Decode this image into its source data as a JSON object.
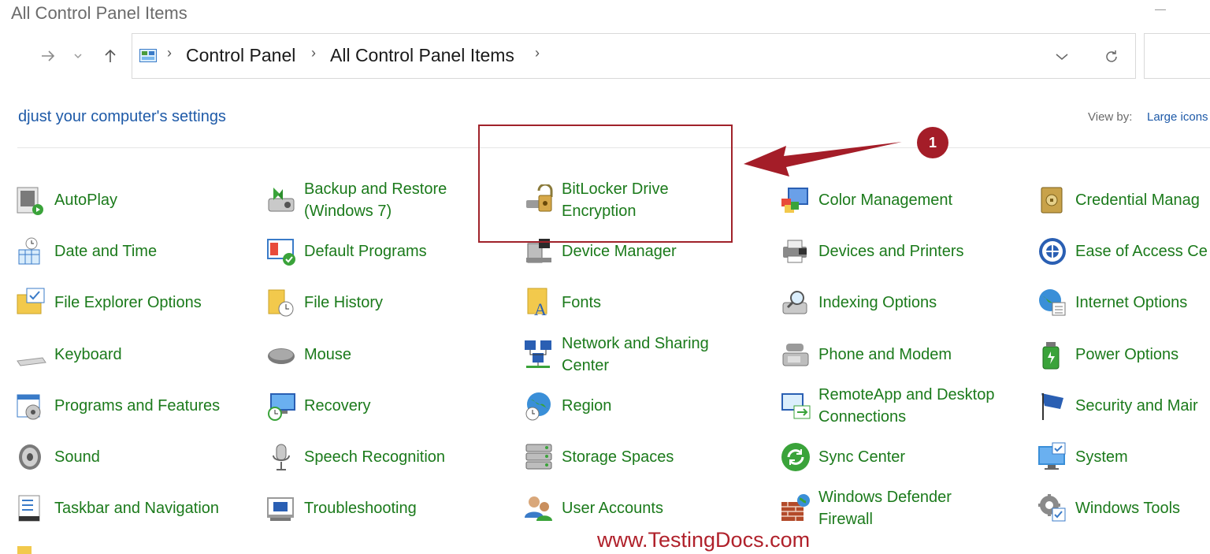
{
  "window": {
    "title": "All Control Panel Items"
  },
  "addressbar": {
    "crumbs": [
      "Control Panel",
      "All Control Panel Items"
    ]
  },
  "header": {
    "heading": "djust your computer's settings",
    "view_by_label": "View by:",
    "view_by_value": "Large icons"
  },
  "items": [
    {
      "label": "AutoPlay",
      "icon": "autoplay-icon"
    },
    {
      "label": "Backup and Restore\n(Windows 7)",
      "icon": "backup-restore-icon"
    },
    {
      "label": "BitLocker Drive\nEncryption",
      "icon": "bitlocker-icon"
    },
    {
      "label": "Color Management",
      "icon": "color-management-icon"
    },
    {
      "label": "Credential Manag",
      "icon": "credential-manager-icon"
    },
    {
      "label": "Date and Time",
      "icon": "date-time-icon"
    },
    {
      "label": "Default Programs",
      "icon": "default-programs-icon"
    },
    {
      "label": "Device Manager",
      "icon": "device-manager-icon"
    },
    {
      "label": "Devices and Printers",
      "icon": "devices-printers-icon"
    },
    {
      "label": "Ease of Access Ce",
      "icon": "ease-of-access-icon"
    },
    {
      "label": "File Explorer Options",
      "icon": "file-explorer-options-icon"
    },
    {
      "label": "File History",
      "icon": "file-history-icon"
    },
    {
      "label": "Fonts",
      "icon": "fonts-icon"
    },
    {
      "label": "Indexing Options",
      "icon": "indexing-options-icon"
    },
    {
      "label": "Internet Options",
      "icon": "internet-options-icon"
    },
    {
      "label": "Keyboard",
      "icon": "keyboard-icon"
    },
    {
      "label": "Mouse",
      "icon": "mouse-icon"
    },
    {
      "label": "Network and Sharing\nCenter",
      "icon": "network-sharing-icon"
    },
    {
      "label": "Phone and Modem",
      "icon": "phone-modem-icon"
    },
    {
      "label": "Power Options",
      "icon": "power-options-icon"
    },
    {
      "label": "Programs and Features",
      "icon": "programs-features-icon"
    },
    {
      "label": "Recovery",
      "icon": "recovery-icon"
    },
    {
      "label": "Region",
      "icon": "region-icon"
    },
    {
      "label": "RemoteApp and Desktop\nConnections",
      "icon": "remoteapp-icon"
    },
    {
      "label": "Security and Mair",
      "icon": "security-maintenance-icon"
    },
    {
      "label": "Sound",
      "icon": "sound-icon"
    },
    {
      "label": "Speech Recognition",
      "icon": "speech-recognition-icon"
    },
    {
      "label": "Storage Spaces",
      "icon": "storage-spaces-icon"
    },
    {
      "label": "Sync Center",
      "icon": "sync-center-icon"
    },
    {
      "label": "System",
      "icon": "system-icon"
    },
    {
      "label": "Taskbar and Navigation",
      "icon": "taskbar-navigation-icon"
    },
    {
      "label": "Troubleshooting",
      "icon": "troubleshooting-icon"
    },
    {
      "label": "User Accounts",
      "icon": "user-accounts-icon"
    },
    {
      "label": "Windows Defender\nFirewall",
      "icon": "firewall-icon"
    },
    {
      "label": "Windows Tools",
      "icon": "windows-tools-icon"
    }
  ],
  "annotation": {
    "step_number": "1",
    "watermark": "www.TestingDocs.com"
  },
  "colors": {
    "link_green": "#1b7a1b",
    "heading_blue": "#1e5aa8",
    "annotation_red": "#a41d28"
  }
}
